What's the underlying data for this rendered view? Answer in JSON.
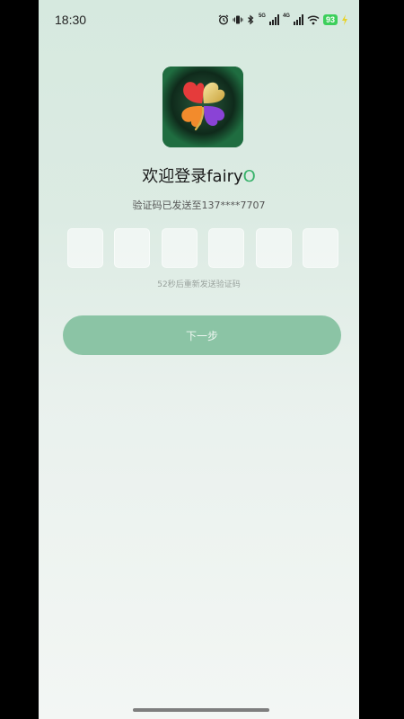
{
  "status_bar": {
    "time": "18:30",
    "net_5g": "5G",
    "net_4g": "4G",
    "battery": "93"
  },
  "login": {
    "welcome": "欢迎登录",
    "brand_prefix": "fairy",
    "brand_suffix": "O",
    "sent_info": "验证码已发送至137****7707",
    "resend_text": "52秒后重新发送验证码",
    "next_label": "下一步",
    "code_length": 6
  },
  "colors": {
    "accent": "#38b26a",
    "button": "#8bc4a5",
    "battery": "#3ccf5b"
  }
}
